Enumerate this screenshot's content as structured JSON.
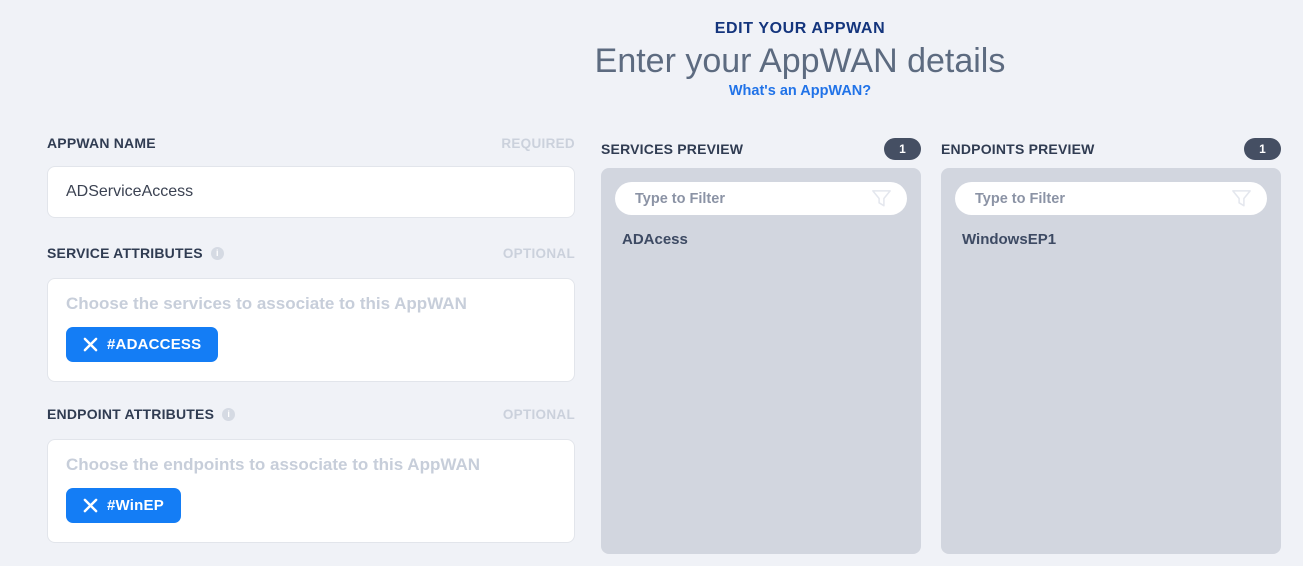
{
  "header": {
    "eyebrow": "EDIT YOUR APPWAN",
    "title": "Enter your AppWAN details",
    "link": "What's an AppWAN?"
  },
  "form": {
    "appwan_name": {
      "label": "APPWAN NAME",
      "required_label": "REQUIRED",
      "value": "ADServiceAccess"
    },
    "service_attributes": {
      "label": "SERVICE ATTRIBUTES",
      "optional_label": "OPTIONAL",
      "placeholder": "Choose the services to associate to this AppWAN",
      "tags": [
        "#ADACCESS"
      ]
    },
    "endpoint_attributes": {
      "label": "ENDPOINT ATTRIBUTES",
      "optional_label": "OPTIONAL",
      "placeholder": "Choose the endpoints to associate to this AppWAN",
      "tags": [
        "#WinEP"
      ]
    }
  },
  "services_preview": {
    "label": "SERVICES PREVIEW",
    "count": "1",
    "filter_placeholder": "Type to Filter",
    "items": [
      "ADAcess"
    ]
  },
  "endpoints_preview": {
    "label": "ENDPOINTS PREVIEW",
    "count": "1",
    "filter_placeholder": "Type to Filter",
    "items": [
      "WindowsEP1"
    ]
  },
  "icons": {
    "info": "i"
  },
  "colors": {
    "accent_blue": "#147df5",
    "navy_heading": "#14357d",
    "link_blue": "#2173e8",
    "subtitle_gray": "#5d6b80",
    "panel_gray": "#d2d6df",
    "badge_dark": "#454f63",
    "muted_label": "#cbd1dc",
    "page_background": "#f0f2f7"
  }
}
